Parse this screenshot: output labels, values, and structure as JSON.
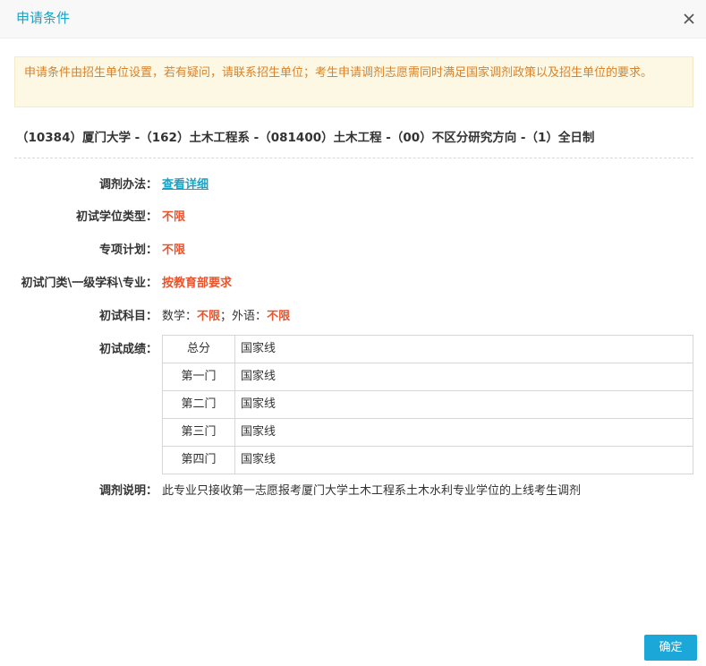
{
  "dialog": {
    "title": "申请条件",
    "close_icon": "close-icon"
  },
  "notice": "申请条件由招生单位设置，若有疑问，请联系招生单位；考生申请调剂志愿需同时满足国家调剂政策以及招生单位的要求。",
  "program": "（10384）厦门大学 -（162）土木工程系 -（081400）土木工程 -（00）不区分研究方向 -（1）全日制",
  "fields": {
    "method": {
      "label": "调剂办法：",
      "value": "查看详细"
    },
    "degree_type": {
      "label": "初试学位类型：",
      "value": "不限"
    },
    "special_plan": {
      "label": "专项计划：",
      "value": "不限"
    },
    "category": {
      "label": "初试门类\\一级学科\\专业：",
      "value": "按教育部要求"
    },
    "subjects": {
      "label": "初试科目：",
      "math_label": "数学：",
      "math_value": "不限",
      "sep": "；",
      "lang_label": "外语：",
      "lang_value": "不限"
    },
    "scores": {
      "label": "初试成绩：",
      "rows": [
        {
          "name": "总分",
          "value": "国家线"
        },
        {
          "name": "第一门",
          "value": "国家线"
        },
        {
          "name": "第二门",
          "value": "国家线"
        },
        {
          "name": "第三门",
          "value": "国家线"
        },
        {
          "name": "第四门",
          "value": "国家线"
        }
      ]
    },
    "note": {
      "label": "调剂说明：",
      "value": "此专业只接收第一志愿报考厦门大学土木工程系土木水利专业学位的上线考生调剂"
    }
  },
  "footer": {
    "confirm_label": "确定"
  },
  "colors": {
    "title": "#18a3c4",
    "notice_text": "#d9822b",
    "notice_bg": "#fcf8e3",
    "highlight": "#e8542d",
    "button": "#1ba8d8"
  }
}
